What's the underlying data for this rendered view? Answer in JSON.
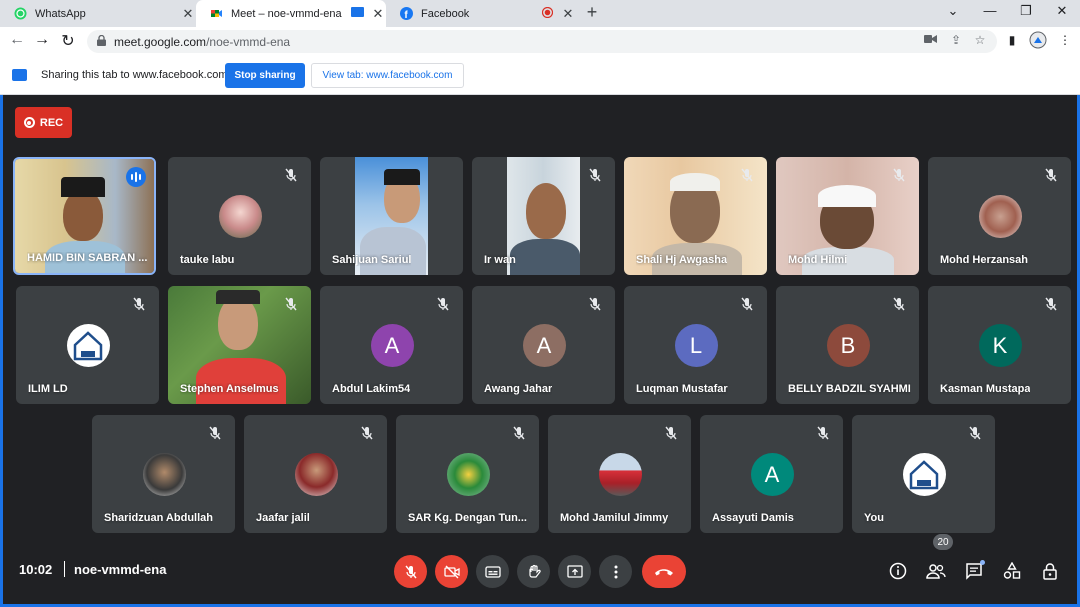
{
  "browser": {
    "tabs": [
      {
        "title": "WhatsApp",
        "icon": "whatsapp-icon"
      },
      {
        "title": "Meet – noe-vmmd-ena",
        "icon": "google-meet-icon"
      },
      {
        "title": "Facebook",
        "icon": "facebook-icon"
      }
    ],
    "url_host": "meet.google.com",
    "url_path": "/noe-vmmd-ena"
  },
  "sharing_bar": {
    "text": "Sharing this tab to www.facebook.com",
    "stop_label": "Stop sharing",
    "view_label": "View tab: www.facebook.com"
  },
  "meet": {
    "rec_label": "REC",
    "time": "10:02",
    "meeting_code": "noe-vmmd-ena",
    "participant_count": "20",
    "participants": [
      {
        "name": "HAMID BIN SABRAN ...",
        "kind": "video",
        "speaking": true
      },
      {
        "name": "tauke labu",
        "kind": "photo-avatar",
        "muted": true
      },
      {
        "name": "Sahijuan Sariul",
        "kind": "video",
        "muted": true
      },
      {
        "name": "Ir wan",
        "kind": "video",
        "muted": true
      },
      {
        "name": "Shali Hj Awgasha",
        "kind": "video",
        "muted": true
      },
      {
        "name": "Mohd Hilmi",
        "kind": "video",
        "muted": true
      },
      {
        "name": "Mohd Herzansah",
        "kind": "photo-avatar",
        "muted": true
      },
      {
        "name": "ILIM LD",
        "kind": "logo-avatar",
        "muted": true
      },
      {
        "name": "Stephen Anselmus",
        "kind": "video",
        "muted": true
      },
      {
        "name": "Abdul Lakim54",
        "kind": "letter-avatar",
        "letter": "A",
        "color": "#8e44ad",
        "muted": true
      },
      {
        "name": "Awang Jahar",
        "kind": "letter-avatar",
        "letter": "A",
        "color": "#8d6e63",
        "muted": true
      },
      {
        "name": "Luqman Mustafar",
        "kind": "letter-avatar",
        "letter": "L",
        "color": "#5c6bc0",
        "muted": true
      },
      {
        "name": "BELLY BADZIL SYAHMI",
        "kind": "letter-avatar",
        "letter": "B",
        "color": "#8d4a3c",
        "muted": true
      },
      {
        "name": "Kasman Mustapa",
        "kind": "letter-avatar",
        "letter": "K",
        "color": "#00695c",
        "muted": true
      },
      {
        "name": "Sharidzuan Abdullah",
        "kind": "photo-avatar",
        "muted": true
      },
      {
        "name": "Jaafar jalil",
        "kind": "photo-avatar",
        "muted": true
      },
      {
        "name": "SAR Kg. Dengan Tun...",
        "kind": "logo-avatar",
        "muted": true
      },
      {
        "name": "Mohd Jamilul Jimmy",
        "kind": "photo-avatar",
        "muted": true
      },
      {
        "name": "Assayuti Damis",
        "kind": "letter-avatar",
        "letter": "A",
        "color": "#00897b",
        "muted": true
      },
      {
        "name": "You",
        "kind": "logo-avatar",
        "muted": true
      }
    ]
  },
  "colors": {
    "accent": "#1a73e8",
    "danger": "#ea4335",
    "tile": "#3c4043",
    "stage": "#202124"
  }
}
